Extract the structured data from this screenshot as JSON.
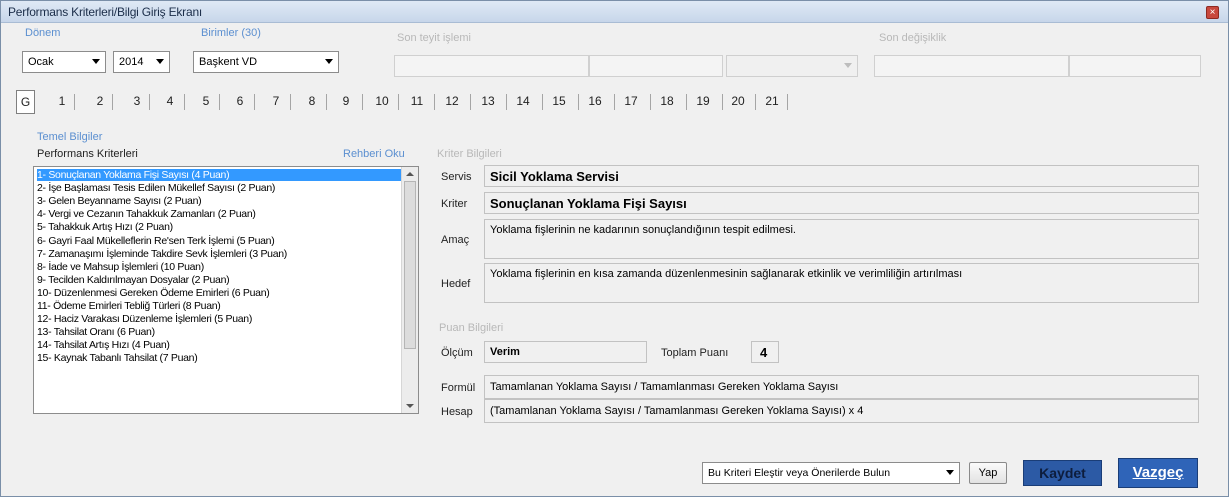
{
  "window": {
    "title": "Performans Kriterleri/Bilgi Giriş Ekranı",
    "close_glyph": "×"
  },
  "header": {
    "donem_label": "Dönem",
    "month": "Ocak",
    "year": "2014",
    "birimler_label": "Birimler (30)",
    "birim": "Başkent VD",
    "son_teyit_label": "Son teyit işlemi",
    "son_degisiklik_label": "Son değişiklik"
  },
  "tabs": [
    "G",
    "1",
    "2",
    "3",
    "4",
    "5",
    "6",
    "7",
    "8",
    "9",
    "10",
    "11",
    "12",
    "13",
    "14",
    "15",
    "16",
    "17",
    "18",
    "19",
    "20",
    "21"
  ],
  "temel": {
    "group_label": "Temel Bilgiler",
    "list_header": "Performans Kriterleri",
    "rehber_link": "Rehberi Oku",
    "items": [
      "1- Sonuçlanan Yoklama Fişi Sayısı (4 Puan)",
      "2- İşe Başlaması Tesis Edilen Mükellef Sayısı (2 Puan)",
      "3- Gelen Beyanname Sayısı (2 Puan)",
      "4- Vergi ve Cezanın Tahakkuk Zamanları (2 Puan)",
      "5- Tahakkuk Artış Hızı (2 Puan)",
      "6- Gayri Faal Mükelleflerin Re'sen Terk İşlemi (5 Puan)",
      "7- Zamanaşımı İşleminde Takdire Sevk İşlemleri (3 Puan)",
      "8- İade ve Mahsup İşlemleri (10 Puan)",
      "9- Tecilden Kaldırılmayan Dosyalar (2 Puan)",
      "10- Düzenlenmesi Gereken Ödeme Emirleri (6 Puan)",
      "11- Ödeme Emirleri Tebliğ Türleri (8 Puan)",
      "12- Haciz Varakası Düzenleme İşlemleri (5 Puan)",
      "13- Tahsilat Oranı (6 Puan)",
      "14- Tahsilat Artış Hızı (4 Puan)",
      "15- Kaynak Tabanlı Tahsilat (7 Puan)"
    ]
  },
  "kriter": {
    "group_label": "Kriter Bilgileri",
    "servis_label": "Servis",
    "servis_value": "Sicil Yoklama Servisi",
    "kriter_label": "Kriter",
    "kriter_value": "Sonuçlanan Yoklama Fişi Sayısı",
    "amac_label": "Amaç",
    "amac_value": "Yoklama fişlerinin ne kadarının sonuçlandığının tespit edilmesi.",
    "hedef_label": "Hedef",
    "hedef_value": "Yoklama fişlerinin en kısa zamanda düzenlenmesinin sağlanarak etkinlik ve verimliliğin artırılması"
  },
  "puan": {
    "group_label": "Puan Bilgileri",
    "olcum_label": "Ölçüm",
    "olcum_value": "Verim",
    "toplam_label": "Toplam Puanı",
    "toplam_value": "4",
    "formul_label": "Formül",
    "formul_value": "Tamamlanan Yoklama Sayısı / Tamamlanması Gereken Yoklama Sayısı",
    "hesap_label": "Hesap",
    "hesap_value": "(Tamamlanan Yoklama Sayısı / Tamamlanması Gereken Yoklama Sayısı) x 4"
  },
  "footer": {
    "elestir_option": "Bu Kriteri Eleştir veya Önerilerde Bulun",
    "yap_label": "Yap",
    "kaydet_label": "Kaydet",
    "vazgec_label": "Vazgeç"
  },
  "colors": {
    "accent": "#3399ff",
    "label_blue": "#5b8fd0",
    "button_blue": "#2f64b8"
  }
}
